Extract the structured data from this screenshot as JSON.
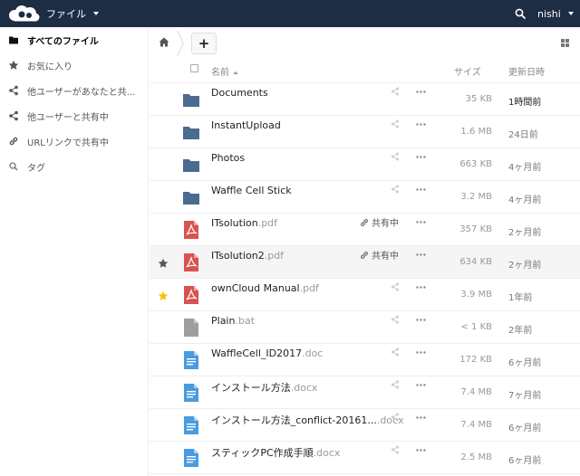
{
  "header": {
    "app_menu_label": "ファイル",
    "user_name": "nishi",
    "bg_color": "#1d2d44"
  },
  "sidebar": {
    "items": [
      {
        "label": "すべてのファイル",
        "icon": "folder-icon",
        "active": true
      },
      {
        "label": "お気に入り",
        "icon": "star-icon",
        "active": false
      },
      {
        "label": "他ユーザーがあなたと共...",
        "icon": "share-icon",
        "active": false
      },
      {
        "label": "他ユーザーと共有中",
        "icon": "share-icon",
        "active": false
      },
      {
        "label": "URLリンクで共有中",
        "icon": "link-icon",
        "active": false
      },
      {
        "label": "タグ",
        "icon": "tag-icon",
        "active": false
      }
    ]
  },
  "controls": {
    "new_label": "+"
  },
  "table": {
    "headers": {
      "name": "名前",
      "size": "サイズ",
      "modified": "更新日時"
    },
    "rows": [
      {
        "name": "Documents",
        "ext": "",
        "type": "folder",
        "size": "35 KB",
        "date": "1時間前",
        "favorite": false,
        "shared": false
      },
      {
        "name": "InstantUpload",
        "ext": "",
        "type": "folder",
        "size": "1.6 MB",
        "date": "24日前",
        "favorite": false,
        "shared": false
      },
      {
        "name": "Photos",
        "ext": "",
        "type": "folder",
        "size": "663 KB",
        "date": "4ヶ月前",
        "favorite": false,
        "shared": false
      },
      {
        "name": "Waffle Cell Stick",
        "ext": "",
        "type": "folder",
        "size": "3.2 MB",
        "date": "4ヶ月前",
        "favorite": false,
        "shared": false
      },
      {
        "name": "ITsolution",
        "ext": ".pdf",
        "type": "pdf",
        "size": "357 KB",
        "date": "2ヶ月前",
        "favorite": false,
        "shared": true,
        "shared_label": "共有中"
      },
      {
        "name": "ITsolution2",
        "ext": ".pdf",
        "type": "pdf",
        "size": "634 KB",
        "date": "2ヶ月前",
        "favorite": false,
        "shared": true,
        "shared_label": "共有中"
      },
      {
        "name": "ownCloud Manual",
        "ext": ".pdf",
        "type": "pdf",
        "size": "3.9 MB",
        "date": "1年前",
        "favorite": true,
        "shared": false
      },
      {
        "name": "Plain",
        "ext": ".bat",
        "type": "file",
        "size": "< 1 KB",
        "date": "2年前",
        "favorite": false,
        "shared": false
      },
      {
        "name": "WaffleCell_ID2017",
        "ext": ".doc",
        "type": "doc",
        "size": "172 KB",
        "date": "6ヶ月前",
        "favorite": false,
        "shared": false
      },
      {
        "name": "インストール方法",
        "ext": ".docx",
        "type": "doc",
        "size": "7.4 MB",
        "date": "7ヶ月前",
        "favorite": false,
        "shared": false
      },
      {
        "name": "インストール方法_conflict-20161...",
        "ext": ".docx",
        "type": "doc",
        "size": "7.4 MB",
        "date": "6ヶ月前",
        "favorite": false,
        "shared": false
      },
      {
        "name": "スティックPC作成手順",
        "ext": ".docx",
        "type": "doc",
        "size": "2.5 MB",
        "date": "6ヶ月前",
        "favorite": false,
        "shared": false
      }
    ]
  },
  "colors": {
    "folder": "#4d6b91",
    "pdf": "#d9534f",
    "doc": "#4a9be0",
    "file": "#9e9e9e",
    "star_favorite": "#f5c400"
  }
}
